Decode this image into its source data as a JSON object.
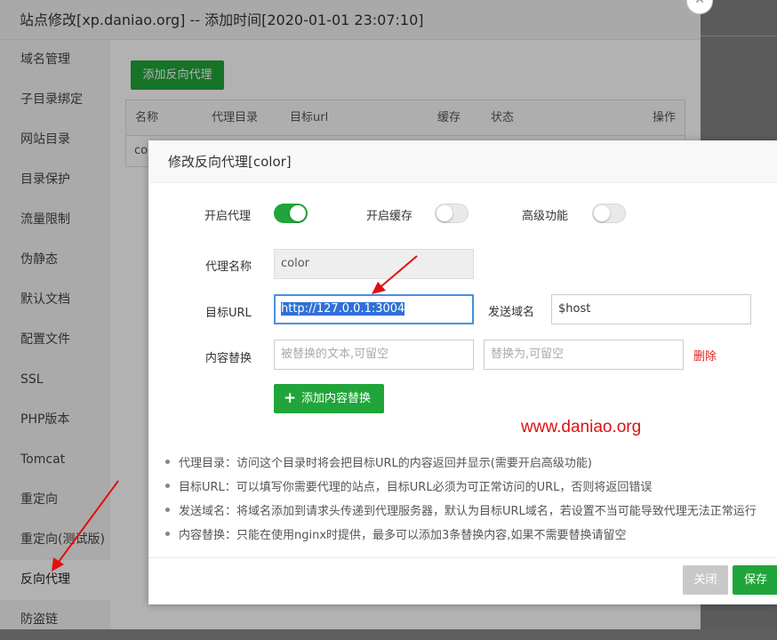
{
  "window": {
    "title": "站点修改[xp.daniao.org] -- 添加时间[2020-01-01 23:07:10]",
    "close_glyph": "✕"
  },
  "sidebar": {
    "items": [
      {
        "label": "域名管理"
      },
      {
        "label": "子目录绑定"
      },
      {
        "label": "网站目录"
      },
      {
        "label": "目录保护"
      },
      {
        "label": "流量限制"
      },
      {
        "label": "伪静态"
      },
      {
        "label": "默认文档"
      },
      {
        "label": "配置文件"
      },
      {
        "label": "SSL"
      },
      {
        "label": "PHP版本"
      },
      {
        "label": "Tomcat"
      },
      {
        "label": "重定向"
      },
      {
        "label": "重定向(测试版)"
      },
      {
        "label": "反向代理",
        "active": true
      },
      {
        "label": "防盗链"
      }
    ]
  },
  "main": {
    "add_button": "添加反向代理",
    "table": {
      "headers": [
        "名称",
        "代理目录",
        "目标url",
        "缓存",
        "状态",
        "操作"
      ],
      "rows": [
        [
          "co"
        ]
      ]
    }
  },
  "dialog": {
    "title": "修改反向代理[color]",
    "toggles": [
      {
        "label": "开启代理",
        "on": true
      },
      {
        "label": "开启缓存",
        "on": false
      },
      {
        "label": "高级功能",
        "on": false
      }
    ],
    "proxy_name_label": "代理名称",
    "proxy_name_value": "color",
    "target_url_label": "目标URL",
    "target_url_value": "http://127.0.0.1:3004",
    "send_domain_label": "发送域名",
    "send_domain_value": "$host",
    "content_replace_label": "内容替换",
    "replace_from_placeholder": "被替换的文本,可留空",
    "replace_to_placeholder": "替换为,可留空",
    "delete_label": "删除",
    "add_content_button": "添加内容替换",
    "watermark": "www.daniao.org",
    "notes": [
      "代理目录：访问这个目录时将会把目标URL的内容返回并显示(需要开启高级功能)",
      "目标URL：可以填写你需要代理的站点，目标URL必须为可正常访问的URL，否则将返回错误",
      "发送域名：将域名添加到请求头传递到代理服务器，默认为目标URL域名，若设置不当可能导致代理无法正常运行",
      "内容替换：只能在使用nginx时提供，最多可以添加3条替换内容,如果不需要替换请留空"
    ],
    "close_button": "关闭",
    "save_button": "保存"
  },
  "colors": {
    "accent_green": "#20a53a",
    "arrow_red": "#e01010",
    "delete_red": "#e02020",
    "selection_blue": "#3070d6"
  }
}
